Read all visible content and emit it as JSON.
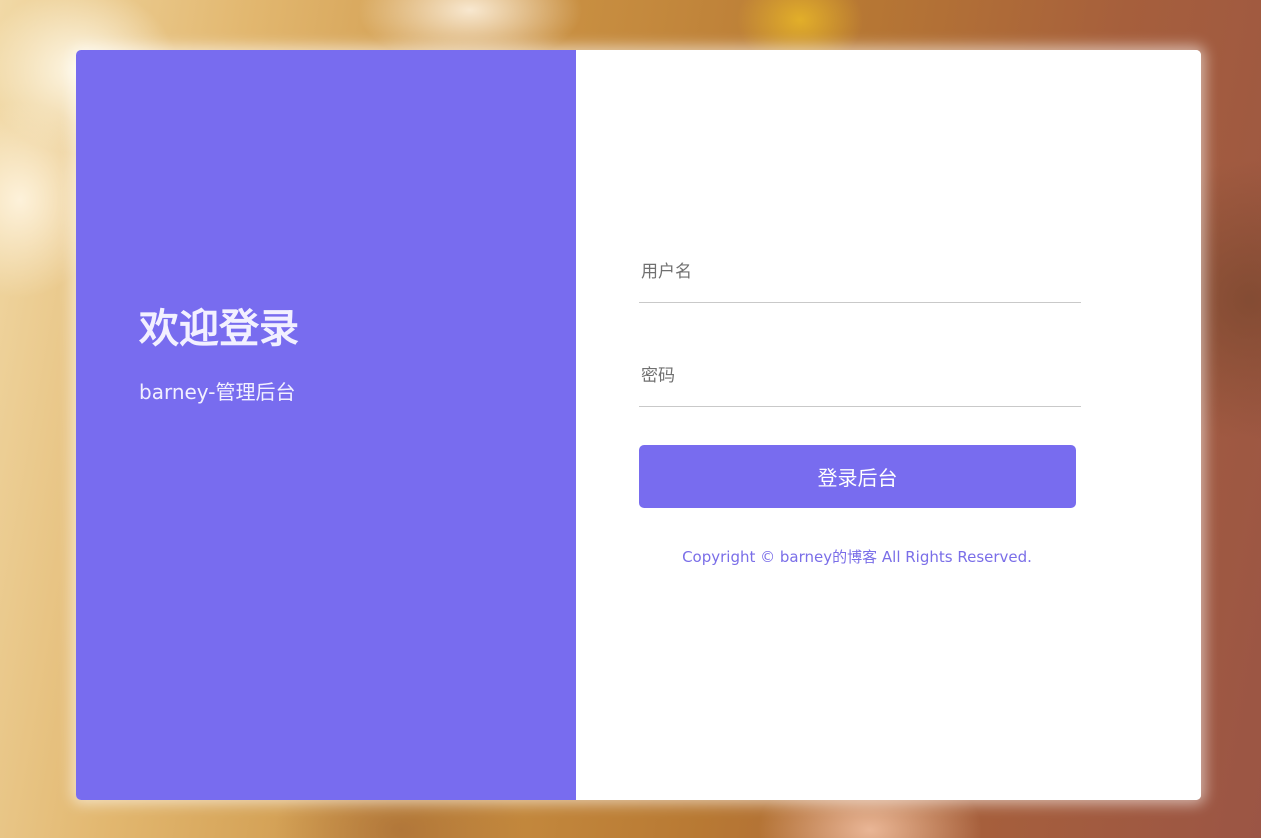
{
  "left_panel": {
    "title": "欢迎登录",
    "subtitle": "barney-管理后台"
  },
  "form": {
    "username": {
      "placeholder": "用户名",
      "value": ""
    },
    "password": {
      "placeholder": "密码",
      "value": ""
    },
    "submit_label": "登录后台"
  },
  "footer": {
    "copyright": "Copyright © barney的博客 All Rights Reserved."
  },
  "colors": {
    "accent": "#786cef",
    "panel_text": "#f2f0ff",
    "copyright_text": "#7a6ee8",
    "field_underline": "#c9c9c9"
  }
}
